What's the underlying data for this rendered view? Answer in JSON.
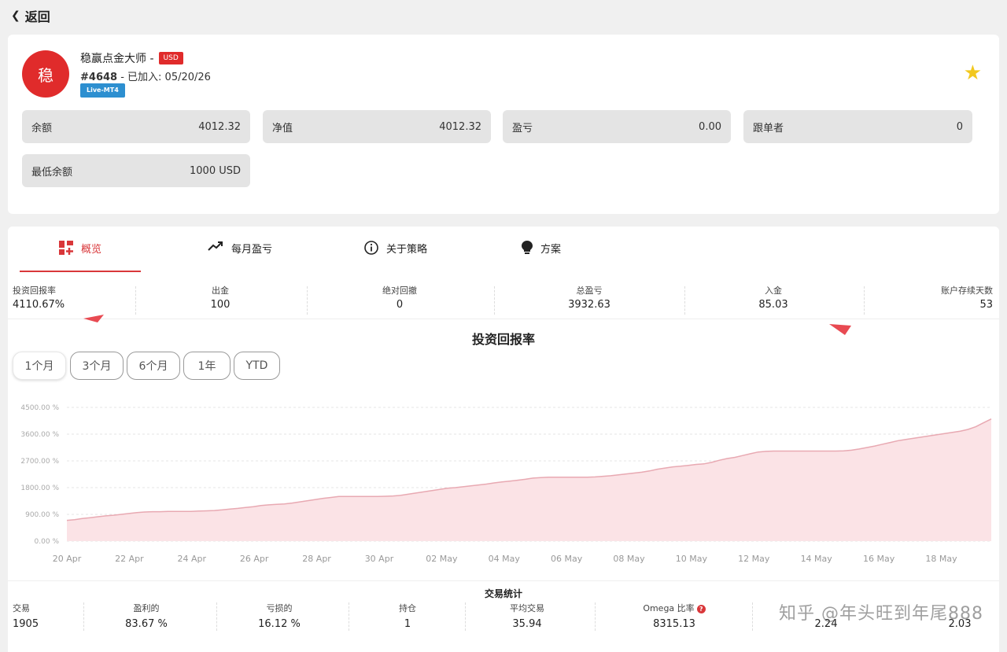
{
  "back_label": "返回",
  "account": {
    "avatar_char": "稳",
    "name": "稳赢点金大师 -",
    "currency_badge": "USD",
    "id": "#4648",
    "joined": " - 已加入: 05/20/26",
    "platform_badge": "Live-MT4"
  },
  "stats": [
    {
      "label": "余额",
      "value": "4012.32"
    },
    {
      "label": "净值",
      "value": "4012.32"
    },
    {
      "label": "盈亏",
      "value": "0.00"
    },
    {
      "label": "跟单者",
      "value": "0"
    },
    {
      "label": "最低余额",
      "value": "1000 USD"
    }
  ],
  "tabs": [
    {
      "label": "概览",
      "icon": "dashboard-icon"
    },
    {
      "label": "每月盈亏",
      "icon": "trend-up-icon"
    },
    {
      "label": "关于策略",
      "icon": "info-icon"
    },
    {
      "label": "方案",
      "icon": "lightbulb-icon"
    }
  ],
  "metrics": [
    {
      "label": "投资回报率",
      "value": "4110.67%"
    },
    {
      "label": "出金",
      "value": "100"
    },
    {
      "label": "绝对回撤",
      "value": "0"
    },
    {
      "label": "总盈亏",
      "value": "3932.63"
    },
    {
      "label": "入金",
      "value": "85.03"
    },
    {
      "label": "账户存续天数",
      "value": "53"
    }
  ],
  "chart_title": "投资回报率",
  "ranges": [
    "1个月",
    "3个月",
    "6个月",
    "1年",
    "YTD"
  ],
  "active_range": "1个月",
  "chart_data": {
    "type": "area",
    "title": "投资回报率",
    "y_ticks": [
      "0.00 %",
      "900.00 %",
      "1800.00 %",
      "2700.00 %",
      "3600.00 %",
      "4500.00 %"
    ],
    "ylim": [
      0,
      4500
    ],
    "x_ticks": [
      "20 Apr",
      "22 Apr",
      "24 Apr",
      "26 Apr",
      "28 Apr",
      "30 Apr",
      "02 May",
      "04 May",
      "06 May",
      "08 May",
      "10 May",
      "12 May",
      "14 May",
      "16 May",
      "18 May"
    ],
    "series": [
      {
        "x": [
          0,
          1,
          2,
          3,
          4,
          5,
          6,
          7,
          8,
          9,
          10,
          11,
          12,
          13,
          14,
          15,
          16,
          17,
          18,
          19,
          20,
          21,
          22,
          23,
          24,
          25,
          26,
          27,
          28,
          29,
          30,
          31,
          32,
          33,
          34,
          35,
          36,
          37,
          38,
          39,
          40,
          41,
          42,
          43,
          44,
          45,
          46,
          47,
          48,
          49,
          50,
          51,
          52,
          53,
          54,
          55,
          56,
          57,
          58,
          59,
          60,
          61,
          62,
          63,
          64,
          65,
          66,
          67,
          68,
          69,
          70,
          71,
          72,
          73,
          74,
          75,
          76,
          77,
          78,
          79,
          80,
          81,
          82,
          83,
          84,
          85,
          86,
          87,
          88,
          89,
          90,
          91,
          92,
          93,
          94,
          95,
          96,
          97,
          98,
          99,
          100,
          101,
          102,
          103,
          104,
          105,
          106,
          107,
          108,
          109,
          110,
          111,
          112,
          113,
          114,
          115,
          116,
          117,
          118,
          119
        ],
        "values": [
          700,
          720,
          760,
          790,
          820,
          850,
          870,
          900,
          930,
          960,
          980,
          990,
          990,
          1000,
          1000,
          1000,
          1000,
          1010,
          1020,
          1030,
          1050,
          1080,
          1100,
          1130,
          1160,
          1200,
          1220,
          1240,
          1250,
          1280,
          1320,
          1360,
          1400,
          1440,
          1470,
          1500,
          1500,
          1500,
          1500,
          1500,
          1500,
          1510,
          1520,
          1540,
          1580,
          1620,
          1660,
          1700,
          1740,
          1780,
          1800,
          1830,
          1860,
          1890,
          1920,
          1960,
          1990,
          2020,
          2050,
          2080,
          2120,
          2140,
          2150,
          2150,
          2150,
          2150,
          2150,
          2150,
          2160,
          2180,
          2200,
          2230,
          2260,
          2290,
          2320,
          2360,
          2420,
          2460,
          2500,
          2520,
          2550,
          2580,
          2600,
          2650,
          2720,
          2780,
          2820,
          2880,
          2940,
          3000,
          3020,
          3030,
          3030,
          3030,
          3030,
          3030,
          3030,
          3030,
          3030,
          3030,
          3040,
          3060,
          3100,
          3150,
          3200,
          3260,
          3320,
          3380,
          3420,
          3460,
          3500,
          3540,
          3580,
          3620,
          3660,
          3700,
          3760,
          3850,
          3980,
          4110
        ]
      }
    ]
  },
  "trade_stats_title": "交易统计",
  "trade_stats": [
    {
      "label": "交易",
      "value": "1905"
    },
    {
      "label": "盈利的",
      "value": "83.67 %"
    },
    {
      "label": "亏损的",
      "value": "16.12 %"
    },
    {
      "label": "持仓",
      "value": "1"
    },
    {
      "label": "平均交易",
      "value": "35.94"
    },
    {
      "label": "Omega 比率",
      "value": "8315.13"
    },
    {
      "label": "",
      "value": "2.24"
    },
    {
      "label": "",
      "value": "2.03"
    }
  ],
  "watermark": "知乎 @年头旺到年尾888",
  "colors": {
    "accent": "#d9373a",
    "area_fill": "#fbe3e6",
    "area_line": "#e8a9b2",
    "badge_blue": "#2d8fd0",
    "star": "#f2c81e"
  }
}
